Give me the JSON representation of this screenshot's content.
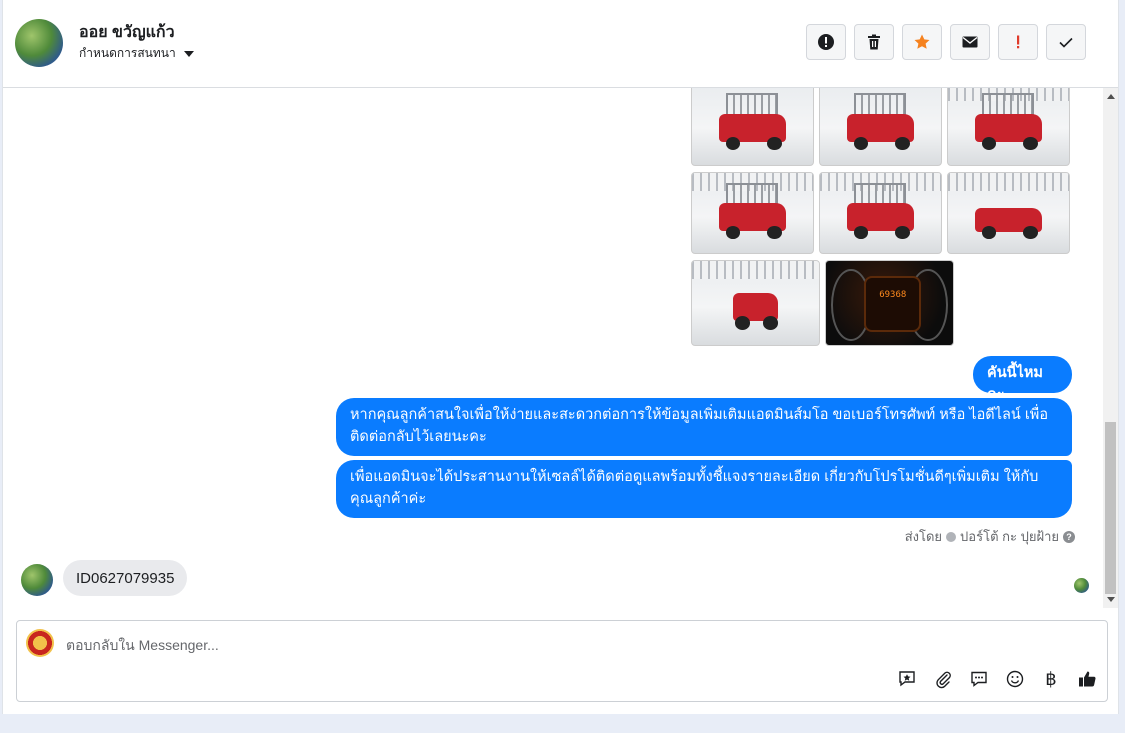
{
  "header": {
    "name": "ออย ขวัญแก้ว",
    "assign_label": "กำหนดการสนทนา",
    "actions": [
      {
        "name": "report-icon",
        "label": "!"
      },
      {
        "name": "trash-icon"
      },
      {
        "name": "star-icon",
        "color": "#f5821f"
      },
      {
        "name": "mail-icon"
      },
      {
        "name": "important-icon",
        "label": "!",
        "color": "#e03b2b"
      },
      {
        "name": "check-icon"
      }
    ]
  },
  "messages": {
    "outgoing": [
      "คันนี้ไหมคะ",
      "หากคุณลูกค้าสนใจเพื่อให้ง่ายและสะดวกต่อการให้ข้อมูลเพิ่มเติมแอดมินส์มโอ ขอเบอร์โทรศัพท์ หรือ ไอดีไลน์ เพื่อติดต่อกลับไว้เลยนะคะ",
      "เพื่อแอดมินจะได้ประสานงานให้เซลล์ได้ติดต่อดูแลพร้อมทั้งชี้แจงรายละเอียด เกี่ยวกับโปรโมชั่นดีๆเพิ่มเติม ให้กับคุณลูกค้าค่ะ"
    ],
    "sent_by_prefix": "ส่งโดย",
    "sent_by_name": "ปอร์โต้ กะ ปุยฝ้าย",
    "incoming": "ID0627079935",
    "dashboard_reading": "69368"
  },
  "composer": {
    "placeholder": "ตอบกลับใน Messenger...",
    "currency_symbol": "฿",
    "tools": [
      "saved-reply-icon",
      "attachment-icon",
      "chat-icon",
      "emoji-icon",
      "currency-icon",
      "like-icon"
    ]
  },
  "colors": {
    "bubble": "#0a7cff",
    "incoming_bubble": "#e9eaed",
    "star": "#f5821f",
    "important": "#e03b2b"
  }
}
